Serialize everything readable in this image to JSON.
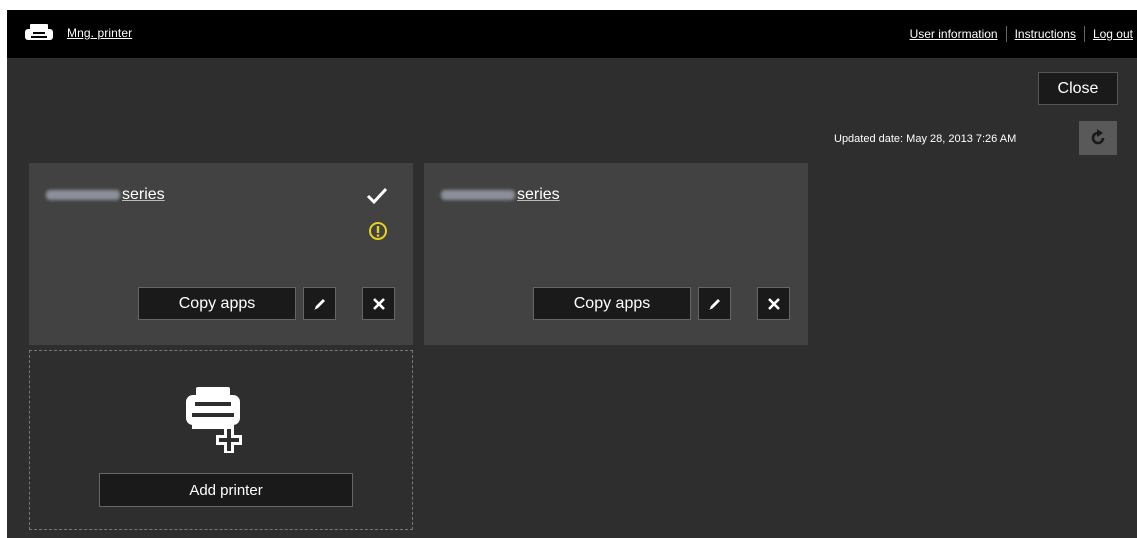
{
  "header": {
    "title": "Mng. printer",
    "links": [
      "User information",
      "Instructions",
      "Log out"
    ]
  },
  "toolbar": {
    "close_label": "Close",
    "updated_text": "Updated date: May 28, 2013 7:26 AM"
  },
  "printers": [
    {
      "name_suffix": "series",
      "copy_label": "Copy apps",
      "status_icons": [
        "check-icon",
        "warning-icon"
      ]
    },
    {
      "name_suffix": "series",
      "copy_label": "Copy apps",
      "status_icons": []
    }
  ],
  "add_printer": {
    "label": "Add printer"
  },
  "colors": {
    "background": "#2e2e2e",
    "topbar": "#000000",
    "card": "#424242",
    "button": "#1a1a1a",
    "warning": "#e6d21e"
  }
}
